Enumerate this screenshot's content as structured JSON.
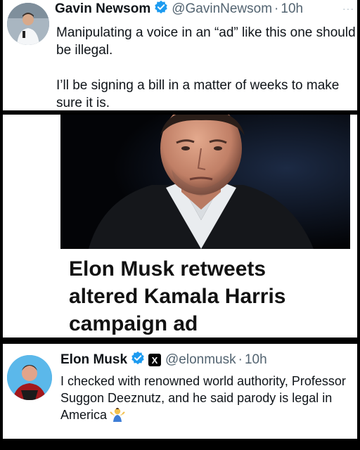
{
  "tweet1": {
    "author_name": "Gavin Newsom",
    "handle": "@GavinNewsom",
    "separator": "·",
    "time": "10h",
    "more": "···",
    "text": "Manipulating a voice in an “ad” like this one should be illegal.\n\nI’ll be signing a bill in a matter of weeks to make sure it is.",
    "avatar_icon": "avatar-newsom",
    "verified_color": "#1d9bf0"
  },
  "news_card": {
    "headline": "Elon Musk retweets\naltered Kamala Harris\ncampaign ad",
    "photo": "photo-elon-musk"
  },
  "tweet2": {
    "author_name": "Elon Musk",
    "badge": "X",
    "handle": "@elonmusk",
    "separator": "·",
    "time": "10h",
    "text": "I checked with renowned world authority, Professor Suggon Deeznutz, and he said parody is legal in America",
    "emoji_icon": "person-shrugging-icon",
    "avatar_icon": "avatar-musk",
    "verified_color": "#1d9bf0"
  }
}
